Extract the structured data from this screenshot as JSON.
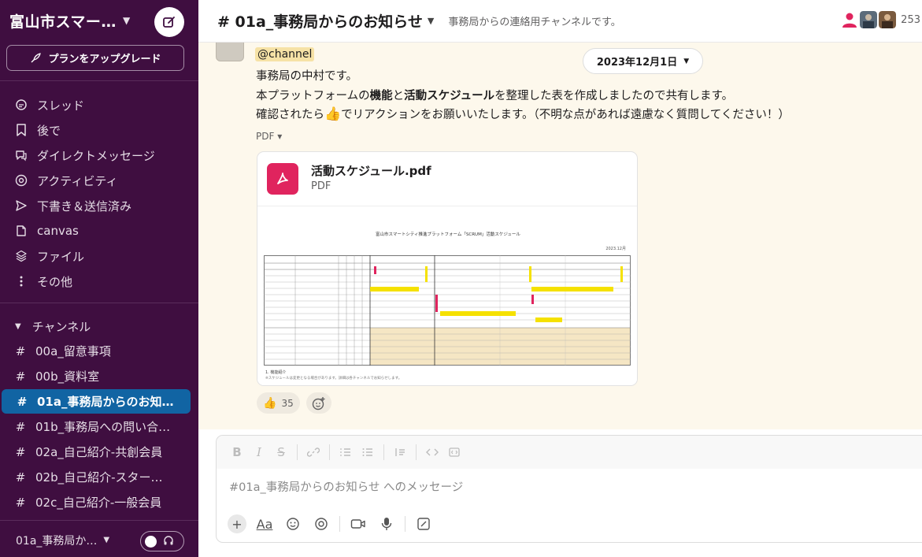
{
  "workspace": {
    "name": "富山市スマー…",
    "upgrade_label": "プランをアップグレード"
  },
  "nav": [
    {
      "label": "スレッド",
      "icon": "threads-icon"
    },
    {
      "label": "後で",
      "icon": "bookmark-icon"
    },
    {
      "label": "ダイレクトメッセージ",
      "icon": "dm-icon"
    },
    {
      "label": "アクティビティ",
      "icon": "mention-icon"
    },
    {
      "label": "下書き＆送信済み",
      "icon": "send-icon"
    },
    {
      "label": "canvas",
      "icon": "canvas-icon"
    },
    {
      "label": "ファイル",
      "icon": "files-icon"
    },
    {
      "label": "その他",
      "icon": "more-icon"
    }
  ],
  "channels_section": {
    "label": "チャンネル"
  },
  "channels": [
    {
      "label": "00a_留意事項",
      "active": false
    },
    {
      "label": "00b_資料室",
      "active": false
    },
    {
      "label": "01a_事務局からのお知…",
      "active": true
    },
    {
      "label": "01b_事務局への問い合…",
      "active": false
    },
    {
      "label": "02a_自己紹介-共創会員",
      "active": false
    },
    {
      "label": "02b_自己紹介-スター…",
      "active": false
    },
    {
      "label": "02c_自己紹介-一般会員",
      "active": false
    }
  ],
  "footer": {
    "current_channel": "01a_事務局か…"
  },
  "channel_header": {
    "title": "# 01a_事務局からのお知らせ",
    "topic": "事務局からの連絡用チャンネルです。",
    "member_count": "253"
  },
  "message": {
    "mention": "@channel",
    "date": "2023年12月1日",
    "line1": "事務局の中村です。",
    "line2_pre": "本プラットフォームの",
    "line2_b1": "機能",
    "line2_mid": "と",
    "line2_b2": "活動スケジュール",
    "line2_post": "を整理した表を作成しましたので共有します。",
    "line3_pre": "確認されたら",
    "line3_emoji": "👍",
    "line3_post": "でリアクションをお願いいたします。（不明な点があれば遠慮なく質問してください！）",
    "pdf_toggle": "PDF ▾",
    "attachment": {
      "name": "活動スケジュール.pdf",
      "type": "PDF",
      "preview_title": "富山市スマートシティ推進プラットフォーム「SCRUM」活動スケジュール",
      "preview_date": "2023.12月",
      "preview_note": "1. 機能紹介",
      "preview_note2": "※スケジュールは変更となる場合があります。詳細は各チャンネルでお知らせします。"
    },
    "reactions": [
      {
        "emoji": "👍",
        "count": "35"
      }
    ]
  },
  "composer": {
    "placeholder": "#01a_事務局からのお知らせ へのメッセージ",
    "value": ""
  },
  "colors": {
    "sidebar_bg": "#3f0e40",
    "active_channel": "#1164a3",
    "message_highlight": "#fdf8ec",
    "pdf_red": "#e0245e",
    "schedule_yellow": "#f5e100"
  }
}
